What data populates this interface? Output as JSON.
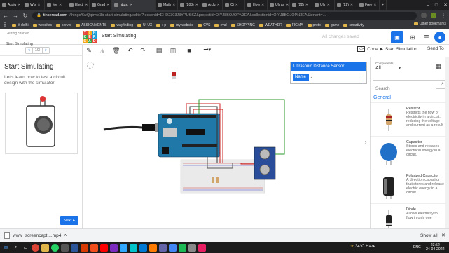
{
  "browser": {
    "tabs": [
      {
        "label": "Assig",
        "active": false
      },
      {
        "label": "Wix",
        "active": false
      },
      {
        "label": "Me",
        "active": false
      },
      {
        "label": "Electi",
        "active": false
      },
      {
        "label": "Grad",
        "active": false
      },
      {
        "label": "https:",
        "active": true
      },
      {
        "label": "Math",
        "active": false
      },
      {
        "label": "(203)",
        "active": false
      },
      {
        "label": "Ardu",
        "active": false
      },
      {
        "label": "Ci",
        "active": false
      },
      {
        "label": "How",
        "active": false
      },
      {
        "label": "Ultras",
        "active": false
      },
      {
        "label": "(22)",
        "active": false
      },
      {
        "label": "Ultr",
        "active": false
      },
      {
        "label": "(22)",
        "active": false
      },
      {
        "label": "Free",
        "active": false
      }
    ],
    "url_domain": "tinkercad.com",
    "url_path": "/things/6wQqbvwj3b-start-simulating/editel?lessonid=EHD2303J3YPUSSZ&projectid=OIYJ8BOJOPN3EA&collectionid=OIYJ8BOJOPN3EA&tenant=...",
    "bookmarks": [
      "iit delhi",
      "websites",
      "server",
      "ASSIGNMENTS",
      "wayfinding",
      "UI UX",
      "r p",
      "my website",
      "CVS",
      "eval",
      "SHOPPING",
      "WEATHER",
      "FIGMA",
      "proto",
      "game",
      "smartivity"
    ],
    "other_bookmarks": "Other bookmarks"
  },
  "app": {
    "breadcrumb_small": "Getting Started",
    "breadcrumb_big": "Start Simulating",
    "logo_letters": [
      "TIN",
      "KER",
      "CAD"
    ],
    "logo_colors": [
      "#e8483c",
      "#f7a81b",
      "#1a9fd9",
      "#37a94b",
      "#e8483c",
      "#1a9fd9",
      "#f7a81b",
      "#37a94b",
      "#e8483c"
    ],
    "project_title": "Start Simulating",
    "save_status": "All changes saved",
    "pager": {
      "prev": "<",
      "count": "1/3",
      "next": ">"
    }
  },
  "toolbar": {
    "code_label": "Code",
    "start_sim_label": "Start Simulation",
    "send_to_label": "Send To"
  },
  "lesson": {
    "title": "Start Simulating",
    "text": "Let's learn how to test a circuit design with the simulator!",
    "next_label": "Next"
  },
  "properties": {
    "title": "Ultrasonic Distance Sensor",
    "name_label": "Name",
    "name_value": "2"
  },
  "components": {
    "label": "Components",
    "filter": "All",
    "search_placeholder": "Search",
    "section": "General",
    "items": [
      {
        "name": "Resistor",
        "desc": "Restricts the flow of electricity in a circuit, reducing the voltage and current as a result"
      },
      {
        "name": "Capacitor",
        "desc": "Stores and releases electrical energy in a circuit."
      },
      {
        "name": "Polarized Capacitor",
        "desc": "A direction capacitor that stores and release electric energy in a circuit."
      },
      {
        "name": "Diode",
        "desc": "Allows electricity to flow in only one"
      }
    ]
  },
  "downloads": {
    "file": "www_screencapt....mp4",
    "show_all": "Show all"
  },
  "taskbar": {
    "weather": "34°C Haze",
    "lang": "ENG",
    "time": "23:52",
    "date": "24-04-2022"
  },
  "accent_color": "#1a73e8"
}
